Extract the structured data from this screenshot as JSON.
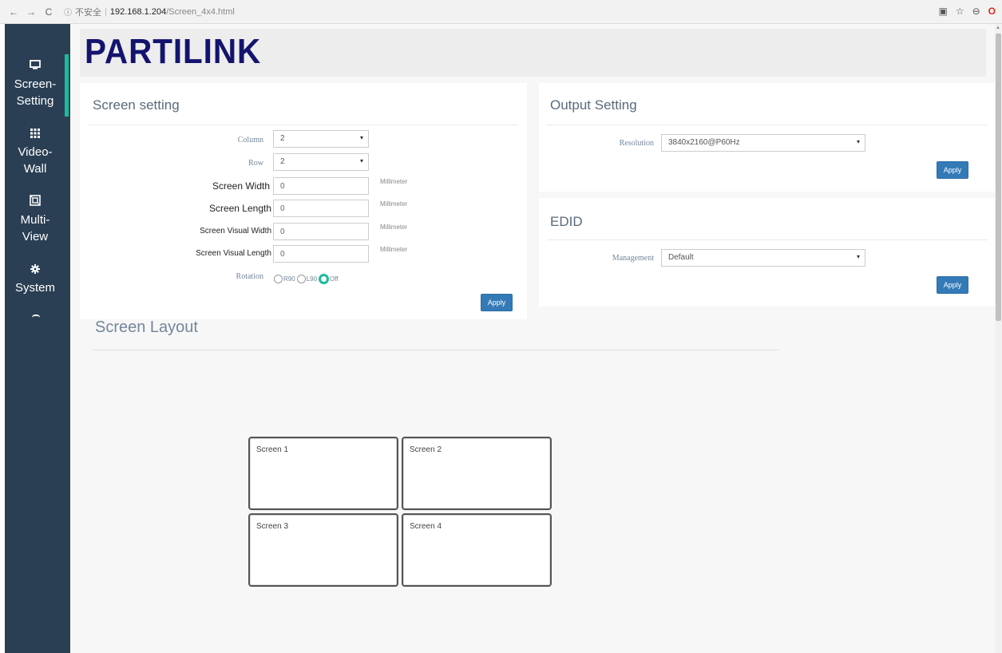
{
  "browser": {
    "back": "←",
    "forward": "→",
    "reload": "C",
    "info_icon": "ⓘ",
    "insecure_label": "不安全",
    "separator": "|",
    "url_host": "192.168.1.204",
    "url_path": "/Screen_4x4.html",
    "right_icons": [
      "translate-icon",
      "star-icon",
      "account-icon",
      "opera-icon"
    ],
    "icon_glyphs": {
      "translate": "▣",
      "star": "☆",
      "account": "⊖",
      "opera": "O"
    }
  },
  "sidebar": {
    "accent_color": "#1abb9c",
    "items": [
      {
        "icon": "monitor-icon",
        "glyph": "🖵",
        "label_line1": "Screen-",
        "label_line2": "Setting",
        "active": true
      },
      {
        "icon": "grid-icon",
        "glyph": "▦",
        "label_line1": "Video-",
        "label_line2": "Wall",
        "active": false
      },
      {
        "icon": "multiview-icon",
        "glyph": "⧈",
        "label_line1": "Multi-",
        "label_line2": "View",
        "active": false
      },
      {
        "icon": "gear-icon",
        "glyph": "⚙",
        "label_line1": "System",
        "label_line2": "",
        "active": false
      }
    ]
  },
  "header": {
    "logo": "PARTILINK"
  },
  "screen_setting": {
    "title": "Screen setting",
    "column": {
      "label": "Column",
      "value": "2"
    },
    "row": {
      "label": "Row",
      "value": "2"
    },
    "screen_width": {
      "label": "Screen Width",
      "value": "0",
      "unit": "Millimeter"
    },
    "screen_length": {
      "label": "Screen Length",
      "value": "0",
      "unit": "Millimeter"
    },
    "visual_width": {
      "label": "Screen Visual Width",
      "value": "0",
      "unit": "Millimeter"
    },
    "visual_length": {
      "label": "Screen Visual Length",
      "value": "0",
      "unit": "Millimeter"
    },
    "rotation": {
      "label": "Rotation",
      "options": [
        "R90",
        "L90",
        "Off"
      ],
      "selected": "Off"
    },
    "apply_label": "Apply"
  },
  "output_setting": {
    "title": "Output Setting",
    "resolution": {
      "label": "Resolution",
      "value": "3840x2160@P60Hz"
    },
    "apply_label": "Apply"
  },
  "edid": {
    "title": "EDID",
    "management": {
      "label": "Management",
      "value": "Default"
    },
    "apply_label": "Apply"
  },
  "screen_layout": {
    "title": "Screen Layout",
    "screens": [
      "Screen 1",
      "Screen 2",
      "Screen 3",
      "Screen 4"
    ]
  },
  "select_caret": "▾"
}
